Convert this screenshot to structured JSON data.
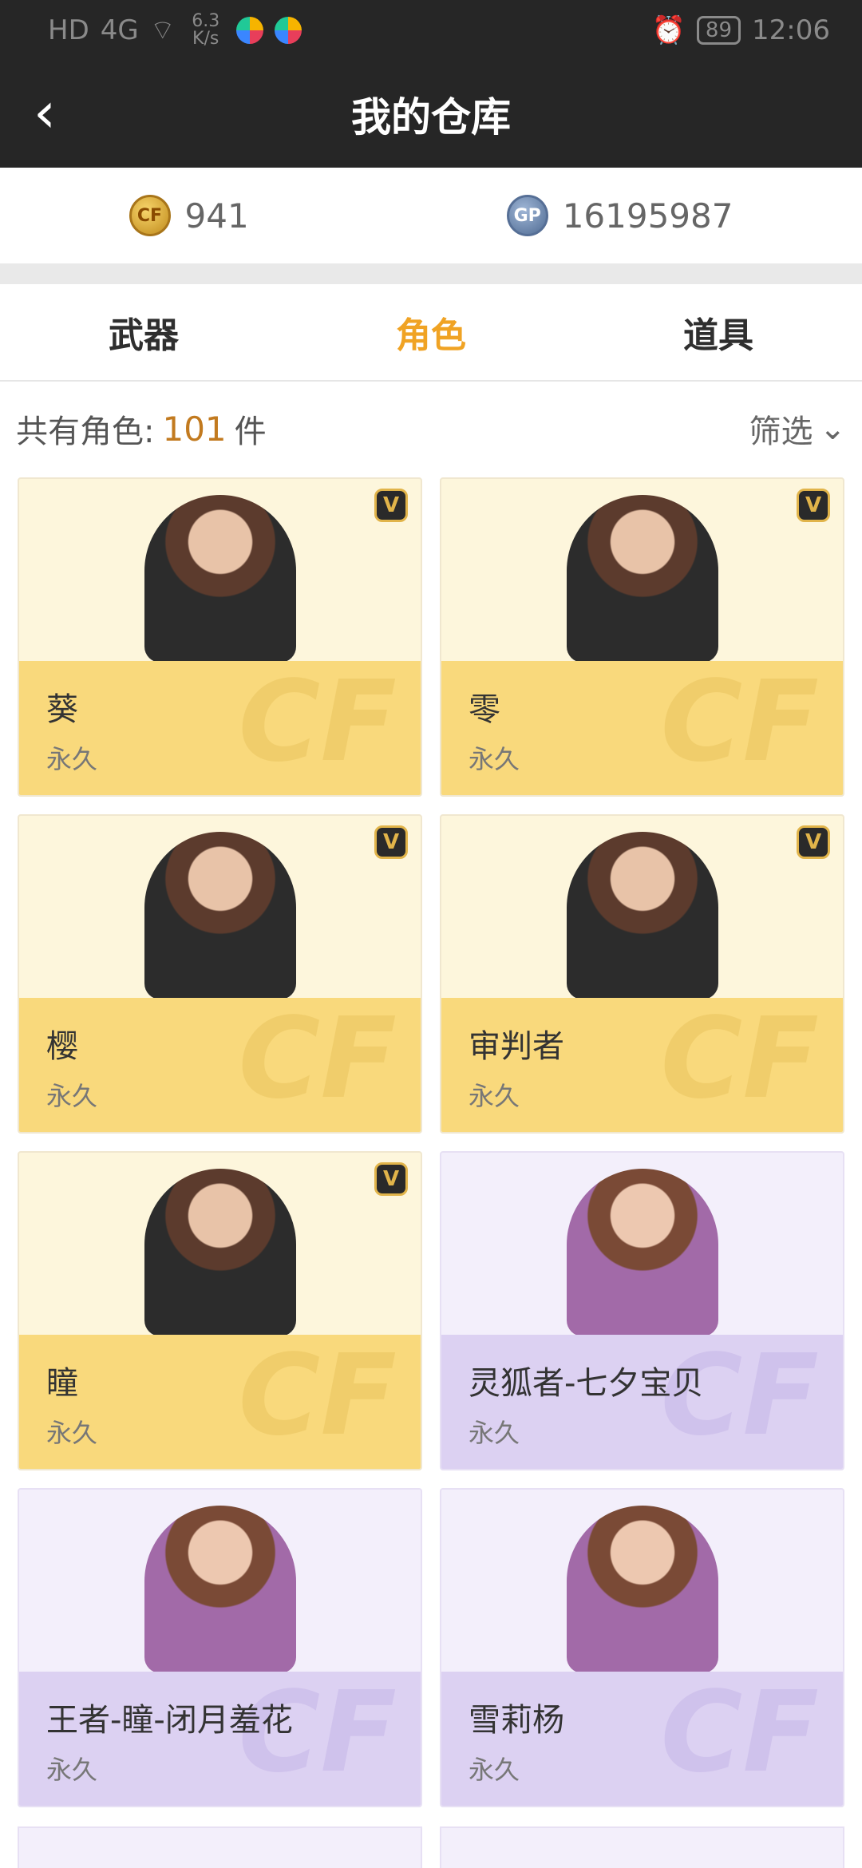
{
  "status_bar": {
    "left_tags": [
      "HD",
      "4G",
      "6.3 K/s"
    ],
    "battery": "89",
    "time": "12:06"
  },
  "header": {
    "title": "我的仓库"
  },
  "currency": {
    "cf_points": "941",
    "gp": "16195987",
    "gp_icon_text": "GP"
  },
  "tabs": [
    {
      "label": "武器",
      "active": false
    },
    {
      "label": "角色",
      "active": true
    },
    {
      "label": "道具",
      "active": false
    }
  ],
  "summary": {
    "prefix": "共有角色:",
    "count": "101",
    "unit": "件",
    "filter_label": "筛选"
  },
  "cards": [
    {
      "name": "葵",
      "duration": "永久",
      "vip": true,
      "theme": "gold"
    },
    {
      "name": "零",
      "duration": "永久",
      "vip": true,
      "theme": "gold"
    },
    {
      "name": "樱",
      "duration": "永久",
      "vip": true,
      "theme": "gold"
    },
    {
      "name": "审判者",
      "duration": "永久",
      "vip": true,
      "theme": "gold"
    },
    {
      "name": "瞳",
      "duration": "永久",
      "vip": true,
      "theme": "gold"
    },
    {
      "name": "灵狐者-七夕宝贝",
      "duration": "永久",
      "vip": false,
      "theme": "purple"
    },
    {
      "name": "王者-瞳-闭月羞花",
      "duration": "永久",
      "vip": false,
      "theme": "purple"
    },
    {
      "name": "雪莉杨",
      "duration": "永久",
      "vip": false,
      "theme": "purple"
    }
  ],
  "icons": {
    "vip_badge": "V",
    "watermark": "CF"
  }
}
